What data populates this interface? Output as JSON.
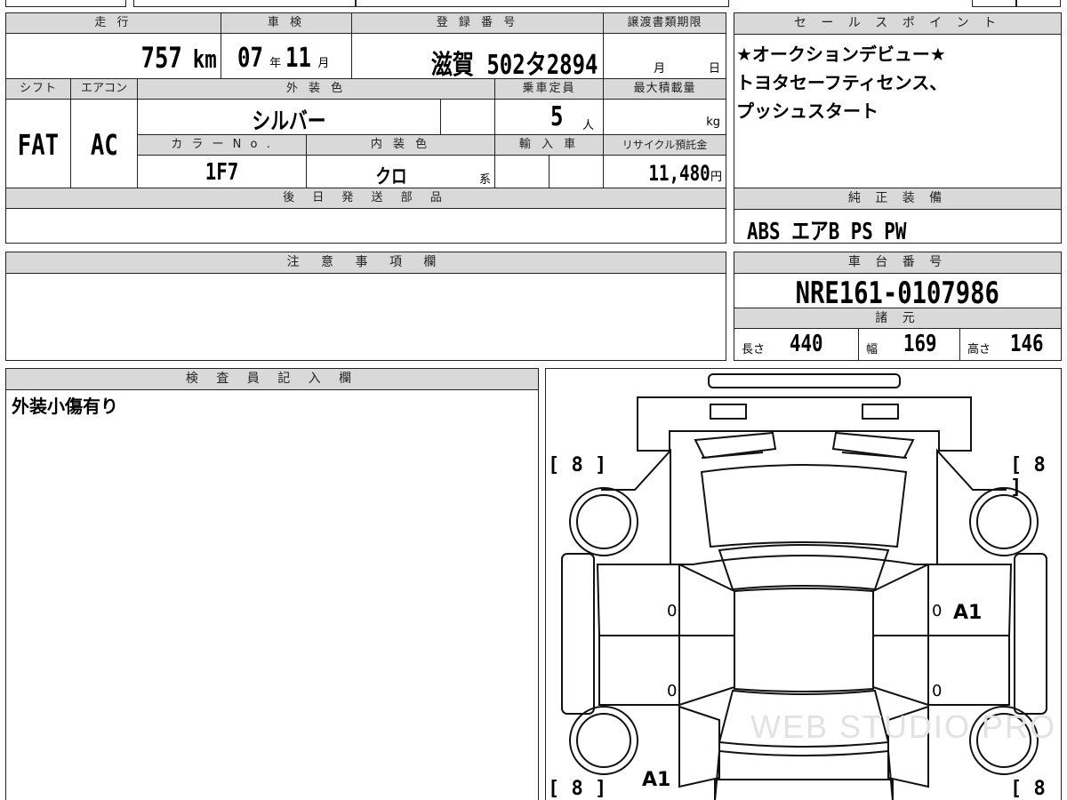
{
  "vehicle": {
    "headers": {
      "mileage": "走 行",
      "inspection": "車 検",
      "registration": "登 録 番 号",
      "transfer_deadline": "譲渡書類期限",
      "shift": "シフト",
      "aircon": "エアコン",
      "exterior_color": "外 装 色",
      "capacity": "乗車定員",
      "max_load": "最大積載量",
      "color_no": "カ ラ ー N o .",
      "interior_color": "内 装 色",
      "import": "輸 入 車",
      "recycle_fee": "リサイクル預託金",
      "later_parts": "後 日 発 送 部 品"
    },
    "mileage_value": "757",
    "mileage_unit": "km",
    "inspection_year": "07",
    "inspection_year_unit": "年",
    "inspection_month": "11",
    "inspection_month_unit": "月",
    "registration_number": "滋賀 502タ2894",
    "transfer_month_unit": "月",
    "transfer_day_unit": "日",
    "shift_value": "FAT",
    "aircon_value": "AC",
    "exterior_color_value": "シルバー",
    "capacity_value": "5",
    "capacity_unit": "人",
    "max_load_unit": "kg",
    "color_no_value": "1F7",
    "interior_color_value": "クロ",
    "interior_color_suffix": "系",
    "recycle_fee_value": "11,480",
    "recycle_fee_unit": "円"
  },
  "sales_point": {
    "header": "セ ー ル ス ポ イ ン ト",
    "lines": [
      "★オークションデビュー★",
      "トヨタセーフティセンス、",
      "プッシュスタート"
    ]
  },
  "equipment": {
    "header": "純 正 装 備",
    "value": "ABS エアB PS PW"
  },
  "caution": {
    "header": "注 意 事 項 欄"
  },
  "chassis": {
    "header": "車 台 番 号",
    "value": "NRE161-0107986"
  },
  "specs": {
    "header": "諸 元",
    "length_label": "長さ",
    "length_value": "440",
    "width_label": "幅",
    "width_value": "169",
    "height_label": "高さ",
    "height_value": "146"
  },
  "inspector": {
    "header": "検 査 員 記 入 欄",
    "note": "外装小傷有り"
  },
  "diagram": {
    "tire_tl": "[ 8 ]",
    "tire_tr": "[ 8 ]",
    "tire_bl": "[ 8 ]",
    "tire_br": "[ 8 ]",
    "mark_right_door": "A1",
    "mark_left_rear": "A1",
    "zero_1": "0",
    "zero_2": "0",
    "zero_3": "0",
    "zero_4": "0",
    "watermark": "WEB STUDIO PRO"
  }
}
